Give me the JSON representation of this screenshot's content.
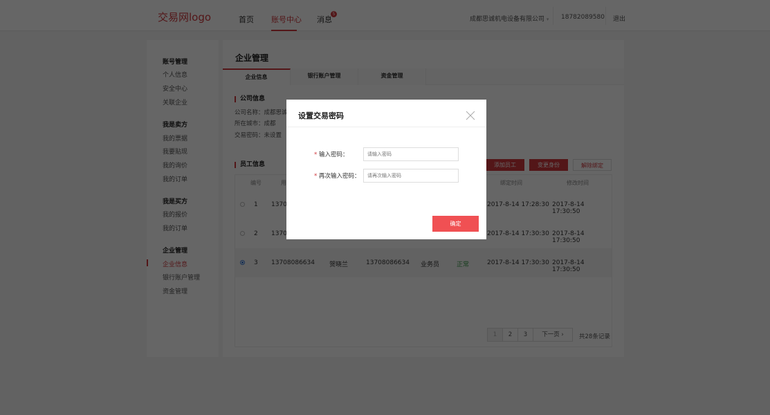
{
  "header": {
    "logo": "交易网logo",
    "nav": [
      "首页",
      "账号中心",
      "消息"
    ],
    "message_badge": "5",
    "company": "成都思诚机电设备有限公司",
    "phone": "18782089580",
    "logout": "退出",
    "accent": "#d0393e"
  },
  "sidebar": {
    "groups": [
      {
        "title": "账号管理",
        "items": [
          "个人信息",
          "安全中心",
          "关联企业"
        ]
      },
      {
        "title": "我是卖方",
        "items": [
          "我的票据",
          "我要贴现",
          "我的询价",
          "我的订单"
        ]
      },
      {
        "title": "我是买方",
        "items": [
          "我的报价",
          "我的订单"
        ]
      },
      {
        "title": "企业管理",
        "items": [
          "企业信息",
          "银行账户管理",
          "资金管理"
        ]
      }
    ],
    "active": "企业信息"
  },
  "main": {
    "title": "企业管理",
    "tabs": [
      "企业信息",
      "银行账户管理",
      "资金管理"
    ],
    "company_section": "公司信息",
    "info": [
      "公司名称：成都思诚",
      "所在城市：成都",
      "交易密码：未设置"
    ],
    "staff_section": "员工信息",
    "buttons": [
      "添加员工",
      "变更身份",
      "解除绑定"
    ],
    "table": {
      "headers": [
        "编号",
        "用",
        "绑定时间",
        "修改时间"
      ],
      "rows": [
        [
          "1",
          "13708",
          "",
          "",
          "",
          "",
          "2017-8-14 17:28:30",
          "2017-8-14 17:30:50"
        ],
        [
          "2",
          "13708",
          "",
          "",
          "",
          "",
          "2017-8-14 17:30:30",
          "2017-8-14 17:30:50"
        ],
        [
          "3",
          "13708086634",
          "贺晓兰",
          "13708086634",
          "业务员",
          "正常",
          "2017-8-14 17:30:30",
          "2017-8-14 17:30:50"
        ]
      ],
      "selected_row": 3
    },
    "pagination": {
      "pages": [
        "1",
        "2",
        "3"
      ],
      "next": "下一页",
      "total": "共28条记录"
    }
  },
  "modal": {
    "title": "设置交易密码",
    "star": "*",
    "label1": "输入密码：",
    "placeholder1": "请输入密码",
    "label2": "再次输入密码：",
    "placeholder2": "请再次输入密码",
    "confirm": "确定"
  }
}
